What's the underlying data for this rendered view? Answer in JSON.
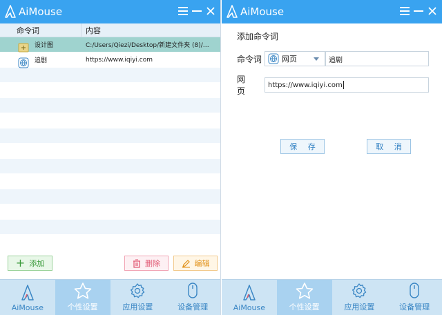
{
  "app_name": "AiMouse",
  "colors": {
    "titlebar": "#39a3f0",
    "selected_row": "#9fd3cf",
    "nav_bg": "#cde4f4",
    "nav_active": "#a9d2f0"
  },
  "left": {
    "columns": {
      "command": "命令词",
      "content": "内容"
    },
    "rows": [
      {
        "command": "设计图",
        "content": "C:/Users/Qiezi/Desktop/新建文件夹 (8)/…",
        "icon": "folder-icon",
        "selected": true
      },
      {
        "command": "追剧",
        "content": "https://www.iqiyi.com",
        "icon": "globe-icon",
        "selected": false
      }
    ],
    "actions": {
      "add": "添加",
      "delete": "删除",
      "edit": "编辑"
    }
  },
  "right": {
    "title": "添加命令词",
    "command_label": "命令词",
    "type_value": "网页",
    "command_value": "追剧",
    "url_label": "网 页",
    "url_value": "https://www.iqiyi.com",
    "save": "保 存",
    "cancel": "取 消"
  },
  "nav": [
    {
      "label": "AiMouse",
      "icon": "aimouse-logo-icon",
      "active": false
    },
    {
      "label": "个性设置",
      "icon": "star-icon",
      "active": true
    },
    {
      "label": "应用设置",
      "icon": "gear-icon",
      "active": false
    },
    {
      "label": "设备管理",
      "icon": "mouse-icon",
      "active": false
    }
  ]
}
